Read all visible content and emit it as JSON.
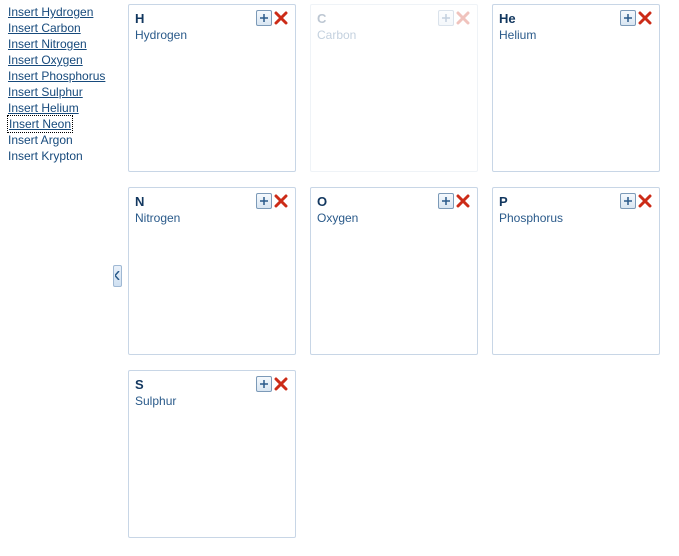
{
  "sidebar": {
    "links": [
      {
        "label": "Insert Hydrogen",
        "selected": false
      },
      {
        "label": "Insert Carbon",
        "selected": false
      },
      {
        "label": "Insert Nitrogen",
        "selected": false
      },
      {
        "label": "Insert Oxygen",
        "selected": false
      },
      {
        "label": "Insert Phosphorus",
        "selected": false
      },
      {
        "label": "Insert Sulphur",
        "selected": false
      },
      {
        "label": "Insert Helium",
        "selected": false
      },
      {
        "label": "Insert Neon",
        "selected": true
      },
      {
        "label": "Insert Argon",
        "selected": false
      },
      {
        "label": "Insert Krypton",
        "selected": false
      }
    ]
  },
  "cards": [
    {
      "symbol": "H",
      "name": "Hydrogen",
      "ghost": false
    },
    {
      "symbol": "C",
      "name": "Carbon",
      "ghost": true
    },
    {
      "symbol": "He",
      "name": "Helium",
      "ghost": false
    },
    {
      "symbol": "N",
      "name": "Nitrogen",
      "ghost": false
    },
    {
      "symbol": "O",
      "name": "Oxygen",
      "ghost": false
    },
    {
      "symbol": "P",
      "name": "Phosphorus",
      "ghost": false
    },
    {
      "symbol": "S",
      "name": "Sulphur",
      "ghost": false
    }
  ],
  "icons": {
    "plus": "plus-icon",
    "close": "close-icon",
    "collapse": "chevron-left-icon"
  }
}
